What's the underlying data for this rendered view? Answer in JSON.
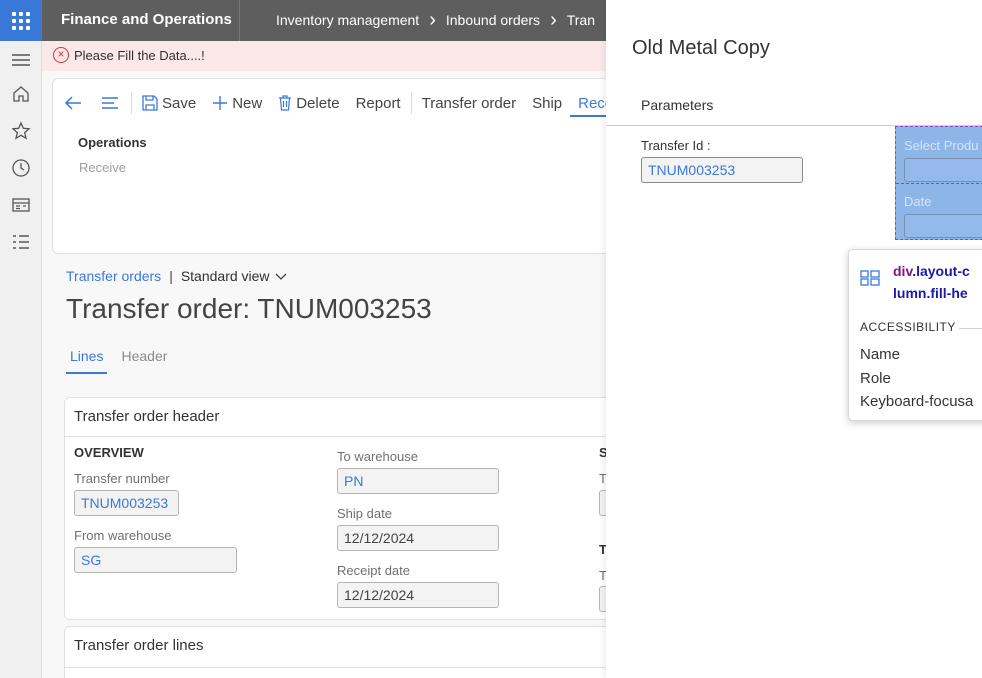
{
  "topbar": {
    "app_title": "Finance and Operations",
    "breadcrumb": [
      "Inventory management",
      "Inbound orders",
      "Tran"
    ]
  },
  "error": {
    "message": "Please Fill the Data....!"
  },
  "actionpane": {
    "save": "Save",
    "new": "New",
    "delete": "Delete",
    "report": "Report",
    "transfer_order": "Transfer order",
    "ship": "Ship",
    "receive_tab": "Recei",
    "group_label": "Operations",
    "group_item": "Receive"
  },
  "page": {
    "breadcrumb_link": "Transfer orders",
    "view": "Standard view",
    "title": "Transfer order: TNUM003253",
    "tabs": [
      "Lines",
      "Header"
    ]
  },
  "header_card": {
    "title": "Transfer order header",
    "overview": "OVERVIEW",
    "transfer_number_label": "Transfer number",
    "transfer_number": "TNUM003253",
    "from_warehouse_label": "From warehouse",
    "from_warehouse": "SG",
    "to_warehouse_label": "To warehouse",
    "to_warehouse": "PN",
    "ship_date_label": "Ship date",
    "ship_date": "12/12/2024",
    "receipt_date_label": "Receipt date",
    "receipt_date": "12/12/2024",
    "col3_label_a": "S",
    "col3_label_b": "T",
    "col3_label_c": "T",
    "col3_label_d": "T"
  },
  "lines_card": {
    "title": "Transfer order lines"
  },
  "panel": {
    "title": "Old Metal Copy",
    "parameters": "Parameters",
    "transfer_id_label": "Transfer Id :",
    "transfer_id": "TNUM003253",
    "select_product_label": "Select Produ",
    "date_label": "Date"
  },
  "inspector": {
    "selector_tag": "div",
    "selector_line1": ".layout-c",
    "selector_line2": "lumn.fill-he",
    "section": "ACCESSIBILITY",
    "rows": [
      "Name",
      "Role",
      "Keyboard-focusa"
    ]
  },
  "colors": {
    "accent": "#3b79d9",
    "topbar": "#5e5e5e",
    "error": "#d13438"
  }
}
